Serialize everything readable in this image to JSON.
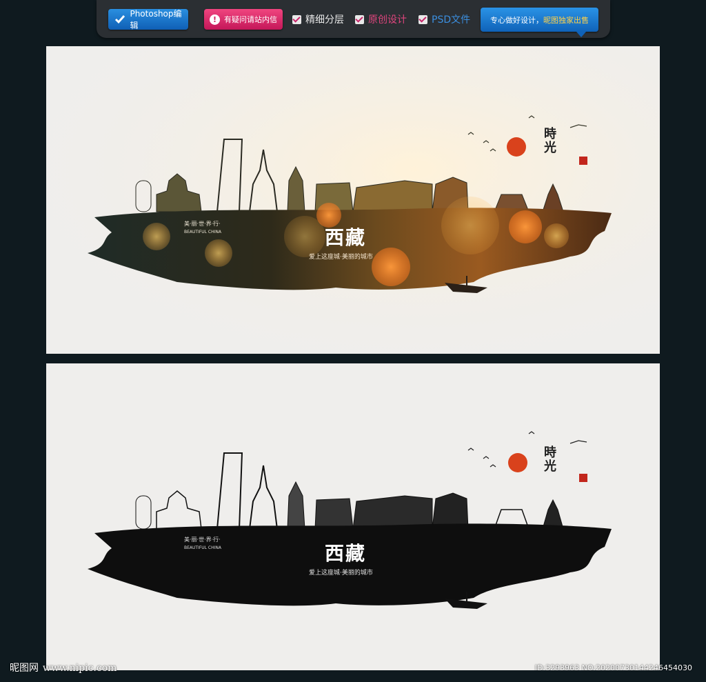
{
  "toolbar": {
    "photoshop_label": "Photoshop编辑",
    "question_label": "有疑问请站内信",
    "feature_1": "精细分层",
    "feature_2": "原创设计",
    "feature_3": "PSD文件",
    "promo_prefix": "专心做好设计，",
    "promo_highlight": "昵图独家出售"
  },
  "poster": {
    "title": "西藏",
    "slogan": "爱上这座城·美丽的城市",
    "tag_cn": "美·丽·世·界·行·",
    "tag_en": "BEAUTIFUL CHINA",
    "side_title": "時光"
  },
  "footer": {
    "logo_text": "昵图网",
    "site": "www.nipic.com",
    "image_id": "ID:3293963 NO:20200730144246454030"
  },
  "colors": {
    "background": "#0f1a1f",
    "paper": "#efeeec",
    "ink": "#111111",
    "sun": "#d9421c",
    "blue_button": "#1f7ad0",
    "pink_button": "#d8246a"
  }
}
